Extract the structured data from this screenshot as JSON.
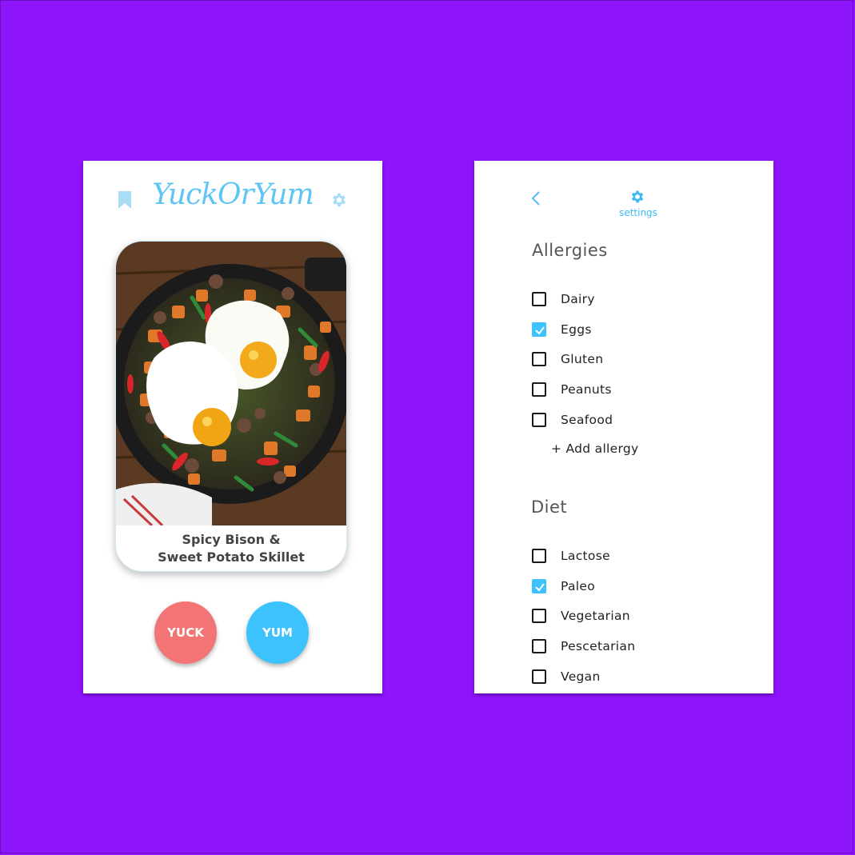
{
  "main_screen": {
    "app_title": "YuckOrYum",
    "dish_name_line1": "Spicy Bison &",
    "dish_name_line2": "Sweet Potato Skillet",
    "yuck_label": "YUCK",
    "yum_label": "YUM",
    "icons": {
      "bookmark": "bookmark-icon",
      "settings": "gear-icon"
    }
  },
  "settings_screen": {
    "header_label": "settings",
    "icons": {
      "back": "chevron-left-icon",
      "settings": "gear-icon"
    },
    "allergies": {
      "title": "Allergies",
      "items": [
        {
          "label": "Dairy",
          "checked": false
        },
        {
          "label": "Eggs",
          "checked": true
        },
        {
          "label": "Gluten",
          "checked": false
        },
        {
          "label": "Peanuts",
          "checked": false
        },
        {
          "label": "Seafood",
          "checked": false
        }
      ],
      "add_label": "+ Add allergy"
    },
    "diet": {
      "title": "Diet",
      "items": [
        {
          "label": "Lactose",
          "checked": false
        },
        {
          "label": "Paleo",
          "checked": true
        },
        {
          "label": "Vegetarian",
          "checked": false
        },
        {
          "label": "Pescetarian",
          "checked": false
        },
        {
          "label": "Vegan",
          "checked": false
        }
      ]
    }
  },
  "colors": {
    "background": "#8e14fb",
    "accent_blue": "#3cc2fc",
    "logo_blue": "#5ec5f5",
    "yuck_red": "#f27474",
    "icon_light_blue": "#a9dcf5"
  }
}
